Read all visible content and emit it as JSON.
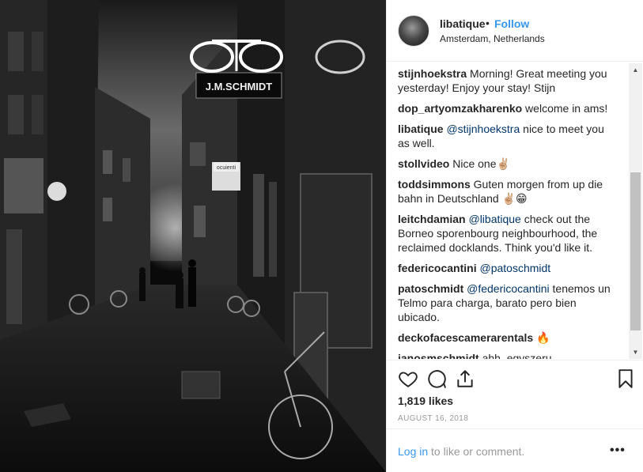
{
  "post": {
    "username": "libatique",
    "separator": "•",
    "follow_label": "Follow",
    "location": "Amsterdam, Netherlands",
    "likes": "1,819 likes",
    "date": "AUGUST 16, 2018",
    "login_link": "Log in",
    "login_rest": " to like or comment.",
    "more_label": "•••"
  },
  "photo": {
    "sign_text": "J.M.SCHMIDT",
    "small_sign_text": "ocuienti"
  },
  "comments": [
    {
      "user": "stijnhoekstra",
      "mention": "",
      "text": " Morning! Great meeting you yesterday! Enjoy your stay! Stijn"
    },
    {
      "user": "dop_artyomzakharenko",
      "mention": "",
      "text": " welcome in ams!"
    },
    {
      "user": "libatique",
      "mention": " @stijnhoekstra",
      "text": " nice to meet you as well."
    },
    {
      "user": "stollvideo",
      "mention": "",
      "text": " Nice one✌🏼"
    },
    {
      "user": "toddsimmons",
      "mention": "",
      "text": " Guten morgen from up die bahn in Deutschland ✌🏼😁"
    },
    {
      "user": "leitchdamian",
      "mention": " @libatique",
      "text": " check out the Borneo sporenbourg neighbourhood, the reclaimed docklands. Think you'd like it."
    },
    {
      "user": "federicocantini",
      "mention": " @patoschmidt",
      "text": ""
    },
    {
      "user": "patoschmidt",
      "mention": " @federicocantini",
      "text": " tenemos un Telmo para charga, barato pero bien ubicado."
    },
    {
      "user": "deckofacescamerarentals",
      "mention": "",
      "text": " 🔥"
    },
    {
      "user": "janosmschmidt",
      "mention": "",
      "text": " ahh, egyszeru lajkvadaszok! mindig visszaelnek a"
    }
  ],
  "icons": {
    "heart": "heart-icon",
    "comment": "comment-icon",
    "share": "share-icon",
    "bookmark": "bookmark-icon",
    "scroll_up": "▲",
    "scroll_down": "▼"
  },
  "colors": {
    "accent": "#3897f0",
    "mention": "#003569",
    "muted": "#999999"
  }
}
